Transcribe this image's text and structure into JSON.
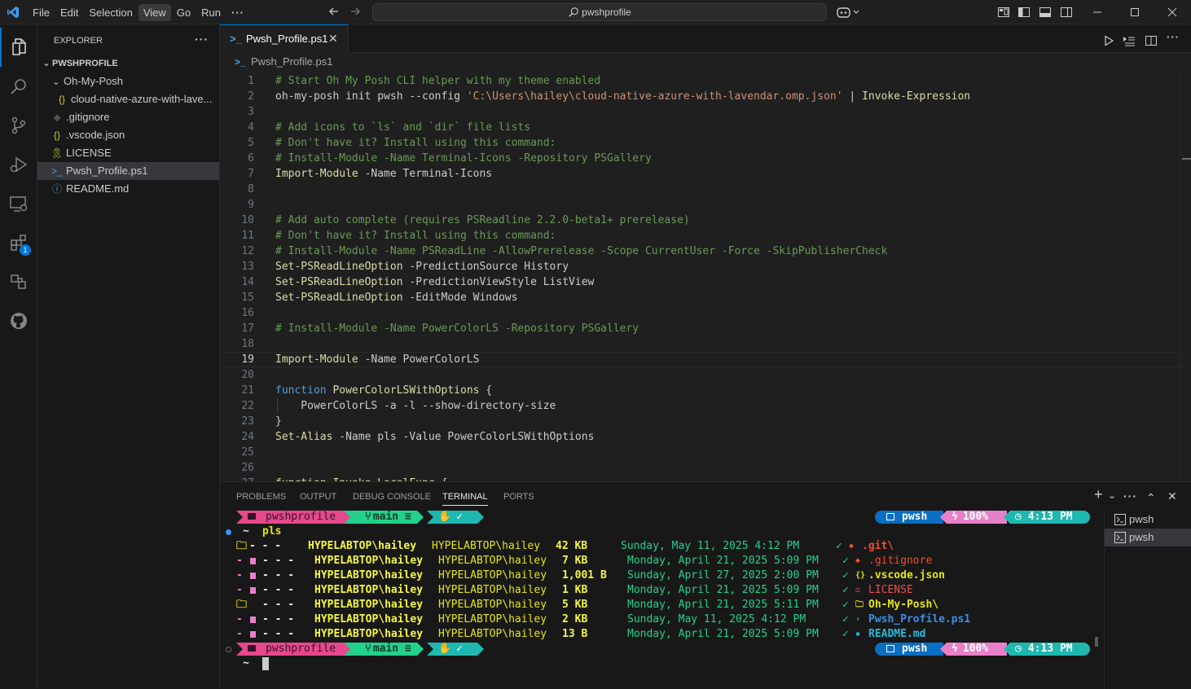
{
  "titlebar": {
    "menus": [
      "File",
      "Edit",
      "Selection",
      "View",
      "Go",
      "Run",
      "···"
    ],
    "active_menu_index": 3,
    "search_text": "pwshprofile"
  },
  "activity_bar": {
    "items": [
      "files-icon",
      "search-icon",
      "source-control-icon",
      "run-debug-icon",
      "remote-explorer-icon",
      "extensions-icon",
      "containers-icon",
      "github-icon"
    ],
    "extensions_badge": "1"
  },
  "sidebar": {
    "title": "EXPLORER",
    "more": "···",
    "root": "PWSHPROFILE",
    "tree": [
      {
        "label": "Oh-My-Posh",
        "type": "folder",
        "depth": 1,
        "expanded": true,
        "icon_color": "#cccccc"
      },
      {
        "label": "cloud-native-azure-with-lave...",
        "type": "json",
        "depth": 2,
        "icon": "{}",
        "icon_color": "#cbcb41"
      },
      {
        "label": ".gitignore",
        "type": "file",
        "depth": 1,
        "icon": "◆",
        "icon_color": "#41535b"
      },
      {
        "label": ".vscode.json",
        "type": "json",
        "depth": 1,
        "icon": "{}",
        "icon_color": "#cbcb41"
      },
      {
        "label": "LICENSE",
        "type": "file",
        "depth": 1,
        "icon": "🎗",
        "icon_color": "#cbcb41"
      },
      {
        "label": "Pwsh_Profile.ps1",
        "type": "ps1",
        "depth": 1,
        "icon": ">_",
        "icon_color": "#4fa2e4",
        "selected": true
      },
      {
        "label": "README.md",
        "type": "md",
        "depth": 1,
        "icon": "ⓘ",
        "icon_color": "#519aba"
      }
    ]
  },
  "editor": {
    "tab_label": "Pwsh_Profile.ps1",
    "breadcrumb": "Pwsh_Profile.ps1",
    "current_line": 19,
    "lines": [
      {
        "n": "1",
        "parts": [
          {
            "t": "# Start Oh My Posh CLI helper with my theme enabled",
            "c": "com"
          }
        ]
      },
      {
        "n": "2",
        "parts": [
          {
            "t": "oh-my-posh init pwsh --config ",
            "c": "txt"
          },
          {
            "t": "'C:\\Users\\hailey\\cloud-native-azure-with-lavendar.omp.json'",
            "c": "str"
          },
          {
            "t": " | ",
            "c": "txt"
          },
          {
            "t": "Invoke-Expression",
            "c": "cmd"
          }
        ]
      },
      {
        "n": "3",
        "parts": []
      },
      {
        "n": "4",
        "parts": [
          {
            "t": "# Add icons to `ls` and `dir` file lists",
            "c": "com"
          }
        ]
      },
      {
        "n": "5",
        "parts": [
          {
            "t": "# Don't have it? Install using this command:",
            "c": "com"
          }
        ]
      },
      {
        "n": "6",
        "parts": [
          {
            "t": "# Install-Module -Name Terminal-Icons -Repository PSGallery",
            "c": "com"
          }
        ]
      },
      {
        "n": "7",
        "parts": [
          {
            "t": "Import-Module",
            "c": "cmd"
          },
          {
            "t": " -Name Terminal-Icons",
            "c": "txt"
          }
        ]
      },
      {
        "n": "8",
        "parts": []
      },
      {
        "n": "9",
        "parts": []
      },
      {
        "n": "10",
        "parts": [
          {
            "t": "# Add auto complete (requires PSReadline 2.2.0-beta1+ prerelease)",
            "c": "com"
          }
        ]
      },
      {
        "n": "11",
        "parts": [
          {
            "t": "# Don't have it? Install using this command:",
            "c": "com"
          }
        ]
      },
      {
        "n": "12",
        "parts": [
          {
            "t": "# Install-Module -Name PSReadLine -AllowPrerelease -Scope CurrentUser -Force -SkipPublisherCheck",
            "c": "com"
          }
        ]
      },
      {
        "n": "13",
        "parts": [
          {
            "t": "Set-PSReadLineOption",
            "c": "cmd"
          },
          {
            "t": " -PredictionSource History",
            "c": "txt"
          }
        ]
      },
      {
        "n": "14",
        "parts": [
          {
            "t": "Set-PSReadLineOption",
            "c": "cmd"
          },
          {
            "t": " -PredictionViewStyle ListView",
            "c": "txt"
          }
        ]
      },
      {
        "n": "15",
        "parts": [
          {
            "t": "Set-PSReadLineOption",
            "c": "cmd"
          },
          {
            "t": " -EditMode Windows",
            "c": "txt"
          }
        ]
      },
      {
        "n": "16",
        "parts": []
      },
      {
        "n": "17",
        "parts": [
          {
            "t": "# Install-Module -Name PowerColorLS -Repository PSGallery",
            "c": "com"
          }
        ]
      },
      {
        "n": "18",
        "parts": []
      },
      {
        "n": "19",
        "parts": [
          {
            "t": "Import-Module",
            "c": "cmd"
          },
          {
            "t": " -Name PowerColorLS",
            "c": "txt"
          }
        ]
      },
      {
        "n": "20",
        "parts": []
      },
      {
        "n": "21",
        "parts": [
          {
            "t": "function",
            "c": "kw"
          },
          {
            "t": " ",
            "c": "txt"
          },
          {
            "t": "PowerColorLSWithOptions",
            "c": "cmd"
          },
          {
            "t": " {",
            "c": "txt"
          }
        ]
      },
      {
        "n": "22",
        "parts": [
          {
            "t": "    PowerColorLS -a -l --show-directory-size",
            "c": "txt"
          }
        ]
      },
      {
        "n": "23",
        "parts": [
          {
            "t": "}",
            "c": "txt"
          }
        ]
      },
      {
        "n": "24",
        "parts": [
          {
            "t": "Set-Alias",
            "c": "cmd"
          },
          {
            "t": " -Name pls -Value PowerColorLSWithOptions",
            "c": "txt"
          }
        ]
      },
      {
        "n": "25",
        "parts": []
      },
      {
        "n": "26",
        "parts": []
      },
      {
        "n": "27",
        "parts": [
          {
            "t": "function Invoke-LocalFunc {",
            "c": "cmd"
          }
        ]
      }
    ]
  },
  "panel": {
    "tabs": [
      "PROBLEMS",
      "OUTPUT",
      "DEBUG CONSOLE",
      "TERMINAL",
      "PORTS"
    ],
    "active_tab_index": 3,
    "actions": [
      "+",
      "⌄",
      "···",
      "⌃",
      "✕"
    ],
    "terminal_instances": [
      "pwsh",
      "pwsh"
    ],
    "selected_instance_index": 1
  },
  "terminal": {
    "prompt": {
      "folder": "pwshprofile",
      "branch": "main ≡",
      "status": "✓",
      "shell": "pwsh",
      "battery": "100%",
      "time": "4:13 PM"
    },
    "command_symbol": "~",
    "command": "pls",
    "rows": [
      {
        "mode": "- - -",
        "owner": "HYPELABTOP\\hailey",
        "group": "HYPELABTOP\\hailey",
        "size": "42 KB",
        "date": "Sunday, May 11, 2025 4:12 PM",
        "name": ".git\\",
        "name_color": "#f14e32",
        "icon": "◆",
        "mode_icon": "🗀"
      },
      {
        "mode": "- - -",
        "owner": "HYPELABTOP\\hailey",
        "group": "HYPELABTOP\\hailey",
        "size": "7 KB",
        "date": "Monday, April 21, 2025 5:09 PM",
        "name": ".gitignore",
        "name_color": "#f14e32",
        "icon": "◆",
        "mode_icon": "▪"
      },
      {
        "mode": "- - -",
        "owner": "HYPELABTOP\\hailey",
        "group": "HYPELABTOP\\hailey",
        "size": "1,001 B",
        "date": "Sunday, April 27, 2025 2:00 PM",
        "name": ".vscode.json",
        "name_color": "#e5e510",
        "icon": "{}",
        "mode_icon": "▪"
      },
      {
        "mode": "- - -",
        "owner": "HYPELABTOP\\hailey",
        "group": "HYPELABTOP\\hailey",
        "size": "1 KB",
        "date": "Monday, April 21, 2025 5:09 PM",
        "name": "LICENSE",
        "name_color": "#f14c4c",
        "icon": "⚖",
        "mode_icon": "▪"
      },
      {
        "mode": "- - -",
        "owner": "HYPELABTOP\\hailey",
        "group": "HYPELABTOP\\hailey",
        "size": "5 KB",
        "date": "Monday, April 21, 2025 5:11 PM",
        "name": "Oh-My-Posh\\",
        "name_color": "#e5e510",
        "icon": "🗀",
        "mode_icon": "🗀"
      },
      {
        "mode": "- - -",
        "owner": "HYPELABTOP\\hailey",
        "group": "HYPELABTOP\\hailey",
        "size": "2 KB",
        "date": "Sunday, May 11, 2025 4:12 PM",
        "name": "Pwsh_Profile.ps1",
        "name_color": "#3b8eea",
        "icon": ">_",
        "mode_icon": "▪"
      },
      {
        "mode": "- - -",
        "owner": "HYPELABTOP\\hailey",
        "group": "HYPELABTOP\\hailey",
        "size": "13 B",
        "date": "Monday, April 21, 2025 5:09 PM",
        "name": "README.md",
        "name_color": "#29b8db",
        "icon": "▪",
        "mode_icon": "▪"
      }
    ],
    "check": "✓",
    "cursor_prompt": "~"
  },
  "colors": {
    "accent": "#0078d4",
    "prompt_pink": "#e5498c",
    "prompt_green": "#23d18b",
    "prompt_teal": "#1eb8b0",
    "prompt_blue": "#0a6fc2",
    "prompt_orchid": "#e780c9"
  }
}
